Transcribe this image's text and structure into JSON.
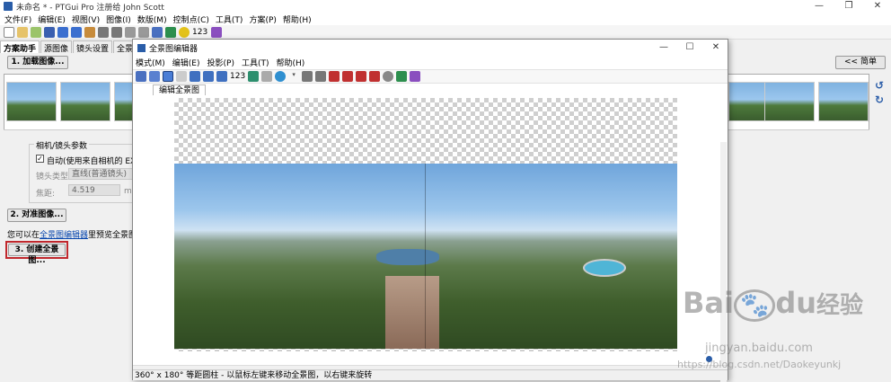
{
  "app": {
    "title": "未命名 * - PTGui Pro 注册给 John Scott",
    "controls": [
      "—",
      "❐",
      "✕"
    ]
  },
  "main_menu": [
    "文件(F)",
    "编辑(E)",
    "视图(V)",
    "图像(I)",
    "数版(M)",
    "控制点(C)",
    "工具(T)",
    "方案(P)",
    "帮助(H)"
  ],
  "tabs": [
    "方案助手",
    "源图像",
    "镜头设置",
    "全景图设置"
  ],
  "load_button": "1. 加载图像...",
  "simple_button": "<< 简单",
  "camera": {
    "group_title": "相机/镜头参数",
    "auto_checkbox": "自动(使用来自相机的 EXIF 数",
    "lens_type_label": "镜头类型:",
    "lens_type_value": "直线(普通镜头)",
    "focal_label": "焦距:",
    "focal_value": "4.519",
    "focal_unit": "mi"
  },
  "align_button": "2. 对准图像...",
  "hint": {
    "prefix": "您可以在",
    "link": "全景图编辑器",
    "suffix": "里预览全景图。或"
  },
  "create_button": "3. 创建全景图...",
  "toolbar_number": "123",
  "dialog": {
    "title": "全景图编辑器",
    "controls": [
      "—",
      "☐",
      "✕"
    ],
    "menu": [
      "模式(M)",
      "编辑(E)",
      "投影(P)",
      "工具(T)",
      "帮助(H)"
    ],
    "tool_number": "123",
    "tab": "编辑全景图",
    "status": "360° x 180° 等距圆柱 - 以鼠标左键来移动全景图，以右键来旋转"
  },
  "watermark": {
    "brand": "Bai",
    "brand2": "du",
    "brand3": "经验",
    "site": "jingyan.baidu.com",
    "url": "https://blog.csdn.net/Daokeyunkj"
  },
  "colors": {
    "accent": "#2a5da8",
    "highlight_border": "#c0282d",
    "link": "#0645ad"
  }
}
